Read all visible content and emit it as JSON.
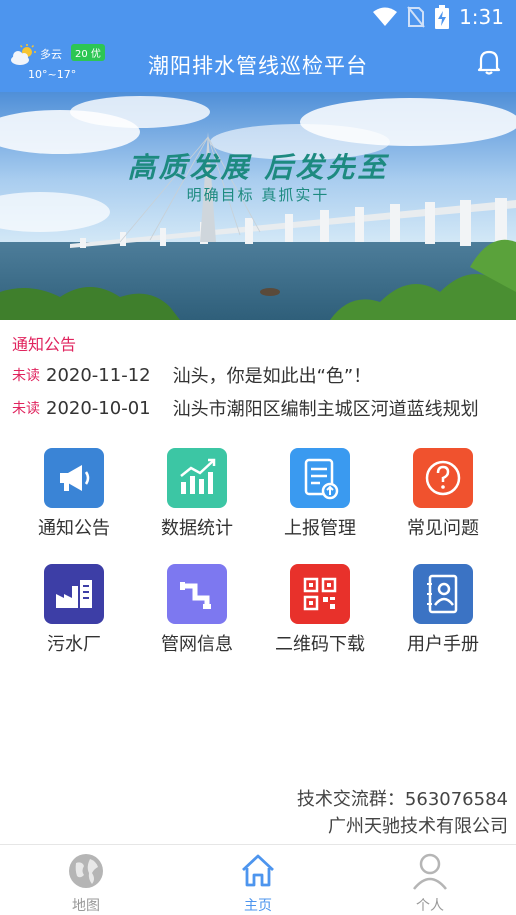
{
  "status_bar": {
    "time": "1:31"
  },
  "header": {
    "title": "潮阳排水管线巡检平台",
    "weather": {
      "condition": "多云",
      "aqi": "20 优",
      "temp_range": "10°~17°"
    }
  },
  "banner": {
    "headline": "高质发展  后发先至",
    "subline": "明确目标  真抓实干"
  },
  "notices": {
    "title": "通知公告",
    "items": [
      {
        "status": "未读",
        "date": "2020-11-12",
        "text": "汕头，你是如此出“色”！"
      },
      {
        "status": "未读",
        "date": "2020-10-01",
        "text": "汕头市潮阳区编制主城区河道蓝线规划"
      }
    ]
  },
  "grid": [
    {
      "label": "通知公告",
      "icon": "megaphone-icon",
      "color": "#3a84d6"
    },
    {
      "label": "数据统计",
      "icon": "stats-chart-icon",
      "color": "#3cc6a4"
    },
    {
      "label": "上报管理",
      "icon": "report-upload-icon",
      "color": "#3a9af0"
    },
    {
      "label": "常见问题",
      "icon": "question-icon",
      "color": "#f0522e"
    },
    {
      "label": "污水厂",
      "icon": "factory-icon",
      "color": "#3d3ea6"
    },
    {
      "label": "管网信息",
      "icon": "pipe-icon",
      "color": "#7d78f0"
    },
    {
      "label": "二维码下载",
      "icon": "qr-code-icon",
      "color": "#e8312b"
    },
    {
      "label": "用户手册",
      "icon": "user-manual-icon",
      "color": "#3b73c4"
    }
  ],
  "contact": {
    "group": "技术交流群：563076584",
    "company": "广州天驰技术有限公司"
  },
  "tabs": [
    {
      "label": "地图",
      "icon": "globe-icon",
      "active": false
    },
    {
      "label": "主页",
      "icon": "home-icon",
      "active": true
    },
    {
      "label": "个人",
      "icon": "person-icon",
      "active": false
    }
  ],
  "colors": {
    "primary": "#4d95ee",
    "accent": "#e0245e",
    "inactive": "#999999"
  }
}
